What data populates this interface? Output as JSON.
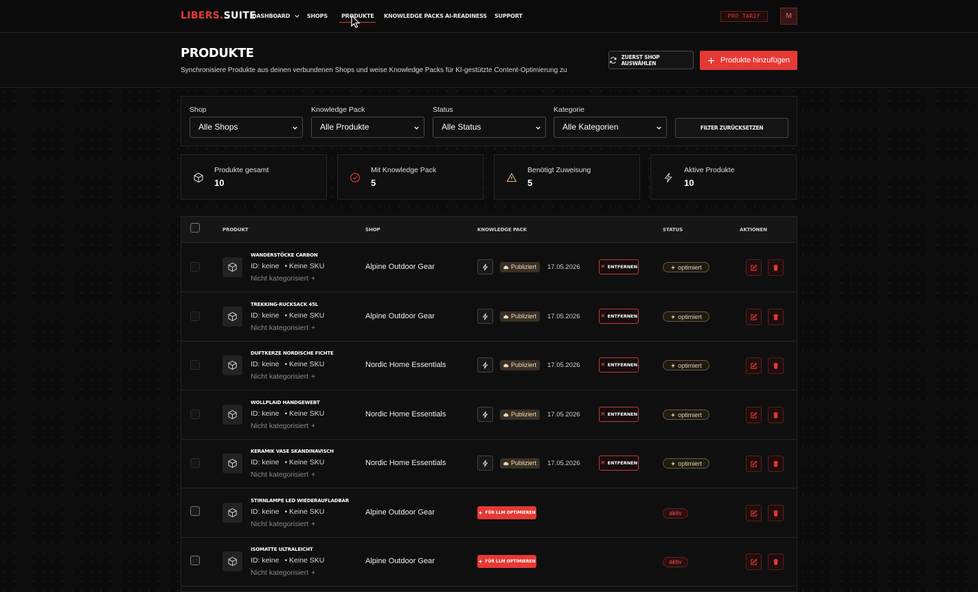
{
  "nav": {
    "logo_part1": "LIBERS",
    "logo_dot": ".",
    "logo_part2": "SUITE",
    "items": [
      {
        "label": "Dashboard"
      },
      {
        "label": "Shops"
      },
      {
        "label": "Produkte"
      },
      {
        "label": "Knowledge Packs"
      },
      {
        "label": "AI-Readiness"
      },
      {
        "label": "Support"
      }
    ],
    "active": "Produkte",
    "plan_badge": "PRO TARIF",
    "avatar_initial": "M"
  },
  "header": {
    "title": "PRODUKTE",
    "subtitle": "Synchronisiere Produkte aus deinen verbundenen Shops und weise Knowledge Packs für KI-gestützte Content-Optimierung zu",
    "select_shop_button": "Zuerst Shop auswählen",
    "add_products_button": "Produkte hinzufügen"
  },
  "filters": {
    "shop": {
      "label": "Shop",
      "value": "Alle Shops"
    },
    "knowledge_pack": {
      "label": "Knowledge Pack",
      "value": "Alle Produkte"
    },
    "status": {
      "label": "Status",
      "value": "Alle Status"
    },
    "category": {
      "label": "Kategorie",
      "value": "Alle Kategorien"
    },
    "reset_button": "Filter zurücksetzen"
  },
  "stats": [
    {
      "label": "Produkte gesamt",
      "value": "10",
      "icon": "cube-icon"
    },
    {
      "label": "Mit Knowledge Pack",
      "value": "5",
      "icon": "check-circle-icon"
    },
    {
      "label": "Benötigt Zuweisung",
      "value": "5",
      "icon": "warning-icon"
    },
    {
      "label": "Aktive Produkte",
      "value": "10",
      "icon": "bolt-icon"
    }
  ],
  "table": {
    "columns": {
      "product": "Produkt",
      "shop": "Shop",
      "knowledge_pack": "Knowledge Pack",
      "status": "Status",
      "actions": "Aktionen"
    },
    "rows": [
      {
        "name": "Wanderstöcke Carbon",
        "id": "ID: keine",
        "sku": "• Keine SKU",
        "category": "Nicht kategorisiert",
        "shop": "Alpine Outdoor Gear",
        "kp_state": "Publiziert",
        "kp_date": "17.05.2026",
        "kp_remove": "Entfernen",
        "status": "optimiert"
      },
      {
        "name": "Trekking-Rucksack 45L",
        "id": "ID: keine",
        "sku": "• Keine SKU",
        "category": "Nicht kategorisiert",
        "shop": "Alpine Outdoor Gear",
        "kp_state": "Publiziert",
        "kp_date": "17.05.2026",
        "kp_remove": "Entfernen",
        "status": "optimiert"
      },
      {
        "name": "Duftkerze Nordische Fichte",
        "id": "ID: keine",
        "sku": "• Keine SKU",
        "category": "Nicht kategorisiert",
        "shop": "Nordic Home Essentials",
        "kp_state": "Publiziert",
        "kp_date": "17.05.2026",
        "kp_remove": "Entfernen",
        "status": "optimiert"
      },
      {
        "name": "Wollplaid Handgewebt",
        "id": "ID: keine",
        "sku": "• Keine SKU",
        "category": "Nicht kategorisiert",
        "shop": "Nordic Home Essentials",
        "kp_state": "Publiziert",
        "kp_date": "17.05.2026",
        "kp_remove": "Entfernen",
        "status": "optimiert"
      },
      {
        "name": "Keramik Vase Skandinavisch",
        "id": "ID: keine",
        "sku": "• Keine SKU",
        "category": "Nicht kategorisiert",
        "shop": "Nordic Home Essentials",
        "kp_state": "Publiziert",
        "kp_date": "17.05.2026",
        "kp_remove": "Entfernen",
        "status": "optimiert"
      },
      {
        "name": "Stirnlampe LED wiederaufladbar",
        "id": "ID: keine",
        "sku": "• Keine SKU",
        "category": "Nicht kategorisiert",
        "shop": "Alpine Outdoor Gear",
        "kp_optimize": "Für LLM optimieren",
        "status": "aktiv"
      },
      {
        "name": "Isomatte ultraleicht",
        "id": "ID: keine",
        "sku": "• Keine SKU",
        "category": "Nicht kategorisiert",
        "shop": "Alpine Outdoor Gear",
        "kp_optimize": "Für LLM optimieren",
        "status": "aktiv"
      }
    ]
  },
  "colors": {
    "accent": "#e53935",
    "background": "#0c0c0c",
    "published_badge": "#3a3025"
  }
}
